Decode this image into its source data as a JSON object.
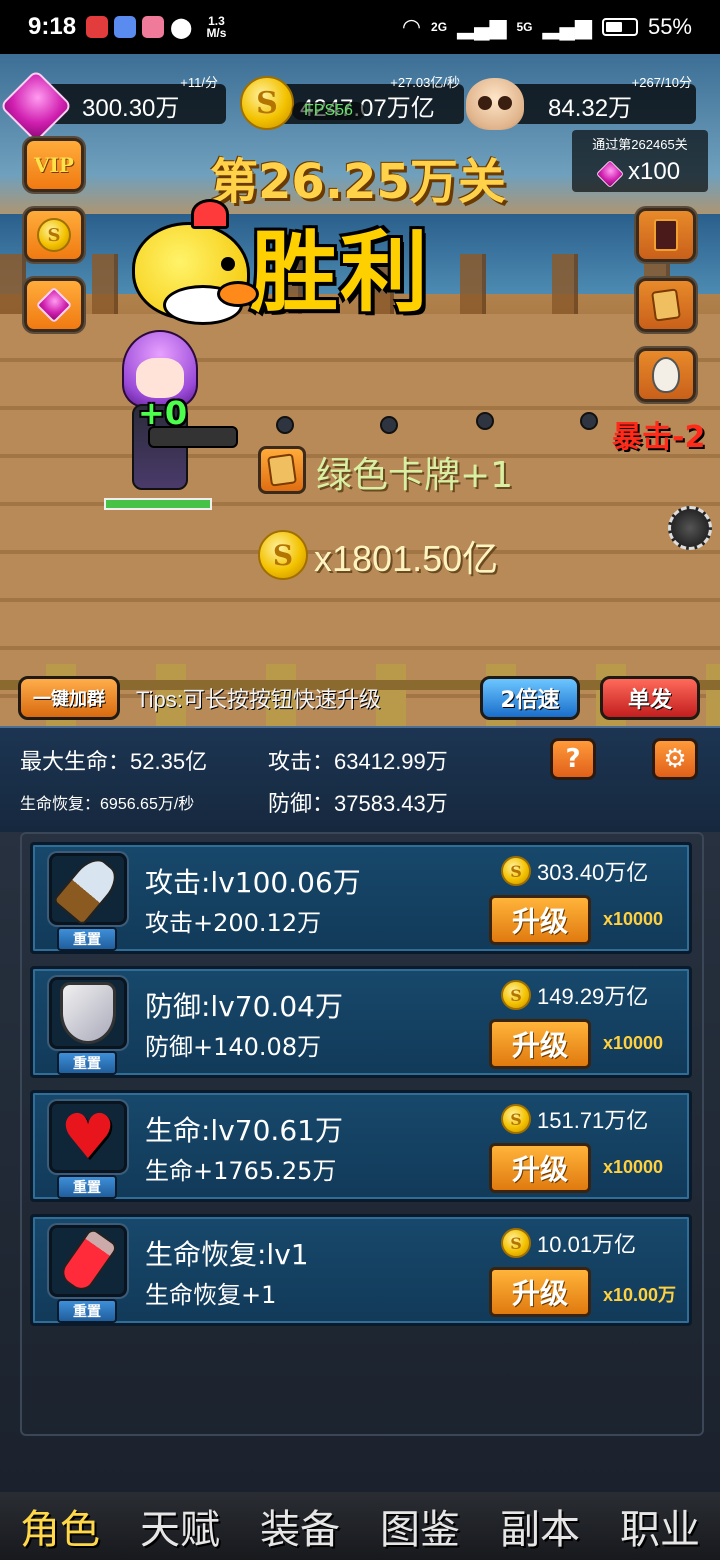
{
  "status_bar": {
    "time": "9:18",
    "net_speed_value": "1.3",
    "net_speed_unit": "M/s",
    "net_2g": "2G",
    "net_5g": "5G",
    "battery": "55%"
  },
  "resources": {
    "gems": {
      "value": "300.30万",
      "rate": "+11/分"
    },
    "coins": {
      "value": "4247.07万亿",
      "rate": "+27.03亿/秒"
    },
    "skulls": {
      "value": "84.32万",
      "rate": "+267/10分"
    }
  },
  "fps": "FPS56",
  "side_buttons": {
    "vip": "VIP"
  },
  "reward_box": {
    "title": "通过第262465关",
    "qty": "x100"
  },
  "stage": {
    "title": "第26.25万关",
    "result": "胜利"
  },
  "battle": {
    "hero_float": "+0",
    "hero_hp": 1.0,
    "crit_text": "暴击-2",
    "drop_card_text": "绿色卡牌+1",
    "drop_coin_text": "x1801.50亿"
  },
  "controls": {
    "join_group": "一键加群",
    "tips": "Tips:可长按按钮快速升级",
    "speed": "2倍速",
    "fire_mode": "单发"
  },
  "stats": {
    "max_hp_label": "最大生命：",
    "max_hp": "52.35亿",
    "attack_label": "攻击：",
    "attack": "63412.99万",
    "regen_label": "生命恢复：",
    "regen": "6956.65万/秒",
    "defense_label": "防御：",
    "defense": "37583.43万",
    "help": "?",
    "settings_icon": "gear-icon"
  },
  "upgrades": [
    {
      "icon": "dagger-icon",
      "title": "攻击:lv100.06万",
      "bonus": "攻击+200.12万",
      "cost": "303.40万亿",
      "button": "升级",
      "multiplier": "x10000",
      "reset": "重置"
    },
    {
      "icon": "shield-icon",
      "title": "防御:lv70.04万",
      "bonus": "防御+140.08万",
      "cost": "149.29万亿",
      "button": "升级",
      "multiplier": "x10000",
      "reset": "重置"
    },
    {
      "icon": "heart-icon",
      "title": "生命:lv70.61万",
      "bonus": "生命+1765.25万",
      "cost": "151.71万亿",
      "button": "升级",
      "multiplier": "x10000",
      "reset": "重置"
    },
    {
      "icon": "potion-icon",
      "title": "生命恢复:lv1",
      "bonus": "生命恢复+1",
      "cost": "10.01万亿",
      "button": "升级",
      "multiplier": "x10.00万",
      "reset": "重置"
    }
  ],
  "nav": [
    "角色",
    "天赋",
    "装备",
    "图鉴",
    "副本",
    "职业"
  ],
  "colors": {
    "accent": "#ffd000",
    "panel": "#17486b",
    "button": "#e07a10"
  }
}
